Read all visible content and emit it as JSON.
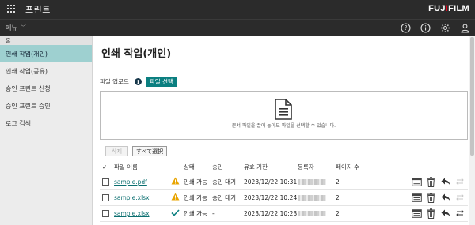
{
  "app": {
    "title": "프린트",
    "brand_prefix": "FUJ",
    "brand_i": "I",
    "brand_suffix": "FILM"
  },
  "subbar": {
    "menu_label": "메뉴"
  },
  "sidebar": {
    "breadcrumb": "홈",
    "items": [
      {
        "label": "인쇄 작업(개인)",
        "active": true
      },
      {
        "label": "인쇄 작업(공유)"
      },
      {
        "label": "승인 프린트 신청"
      },
      {
        "label": "승인 프린트 승인"
      },
      {
        "label": "로그 검색"
      }
    ]
  },
  "main": {
    "title": "인쇄 작업(개인)",
    "upload_label": "파일 업로드",
    "file_button": "파일 선택",
    "drop_text": "문서 파일을 끌어 놓아도 파일을 선택할 수 있습니다.",
    "delete_button": "삭제",
    "select_all_button": "すべて選択"
  },
  "table": {
    "headers": {
      "check": "✓",
      "name": "파일 이름",
      "status": "상태",
      "approval": "승인",
      "expires": "유효 기한",
      "registrant": "등록자",
      "pages": "페이지 수"
    },
    "rows": [
      {
        "name": "sample.pdf",
        "state_icon": "warning-icon",
        "status": "인쇄 가능",
        "approval": "승인 대기",
        "expires": "2023/12/22 10:31",
        "pages": "2"
      },
      {
        "name": "sample.xlsx",
        "state_icon": "warning-icon",
        "status": "인쇄 가능",
        "approval": "승인 대기",
        "expires": "2023/12/22 10:24",
        "pages": "2"
      },
      {
        "name": "sample.xlsx",
        "state_icon": "check-icon",
        "status": "인쇄 가능",
        "approval": "-",
        "expires": "2023/12/22 10:23",
        "pages": "2"
      }
    ]
  },
  "colors": {
    "topbar": "#2b2b2b",
    "accent": "#0b7f80",
    "active_nav": "#9ed0d0",
    "warning": "#e8a400",
    "brand_red": "#e0001a"
  }
}
